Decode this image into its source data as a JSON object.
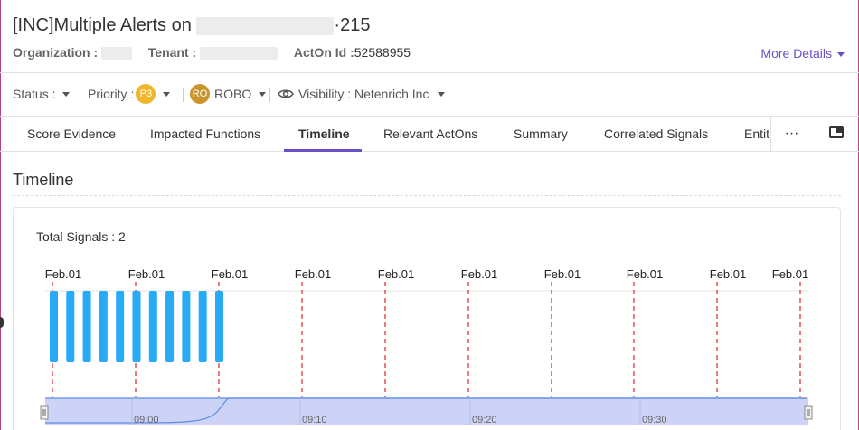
{
  "header": {
    "title_prefix": "[INC]Multiple Alerts on ",
    "title_suffix": "·215",
    "org_label": "Organization :",
    "tenant_label": "Tenant :",
    "acton_label": "ActOn Id :",
    "acton_value": "52588955",
    "more_details": "More Details"
  },
  "filters": {
    "status": "Status :",
    "priority": "Priority :",
    "priority_badge": "P3",
    "owner_badge": "RO",
    "owner": "ROBO",
    "visibility": "Visibility : Netenrich Inc"
  },
  "tabs": [
    {
      "label": "Score Evidence"
    },
    {
      "label": "Impacted Functions"
    },
    {
      "label": "Timeline",
      "active": true
    },
    {
      "label": "Relevant ActOns"
    },
    {
      "label": "Summary"
    },
    {
      "label": "Correlated Signals"
    },
    {
      "label": "Entit"
    }
  ],
  "tab_more": "···",
  "section": {
    "title": "Timeline",
    "total_signals": "Total Signals : 2"
  },
  "colors": {
    "accent": "#6a4fc7",
    "bar": "#29aaf4",
    "marker": "#d9262c",
    "navigator_fill": "#ccd3f7",
    "navigator_line": "#5b8de0"
  },
  "chart_data": {
    "type": "bar",
    "marker_labels": [
      "Feb.01",
      "Feb.01",
      "Feb.01",
      "Feb.01",
      "Feb.01",
      "Feb.01",
      "Feb.01",
      "Feb.01",
      "Feb.01",
      "Feb.01"
    ],
    "bar_count": 11,
    "navigator_ticks": [
      "09:00",
      "09:10",
      "09:20",
      "09:30"
    ]
  }
}
